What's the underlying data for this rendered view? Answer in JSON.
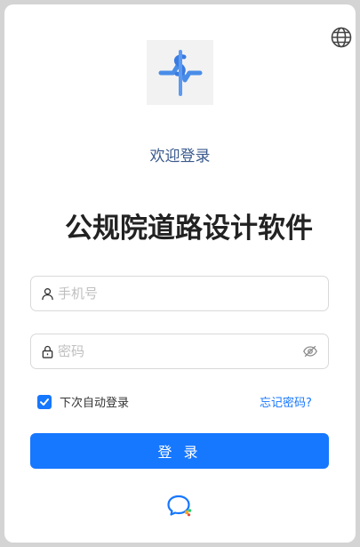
{
  "welcome": "欢迎登录",
  "app_title": "公规院道路设计软件",
  "phone_field": {
    "placeholder": "手机号",
    "value": ""
  },
  "password_field": {
    "placeholder": "密码",
    "value": ""
  },
  "remember_me": {
    "label": "下次自动登录",
    "checked": true
  },
  "forgot_password": "忘记密码?",
  "login_button": "登 录",
  "icons": {
    "language": "globe-icon",
    "logo": "app-logo",
    "phone_prefix": "user-icon",
    "password_prefix": "lock-icon",
    "password_toggle": "eye-off-icon",
    "alt_login": "chat-icon"
  },
  "colors": {
    "primary": "#1677ff",
    "welcome_text": "#3a5a8c",
    "title_text": "#222222",
    "frame_background": "#d4d4d4"
  }
}
